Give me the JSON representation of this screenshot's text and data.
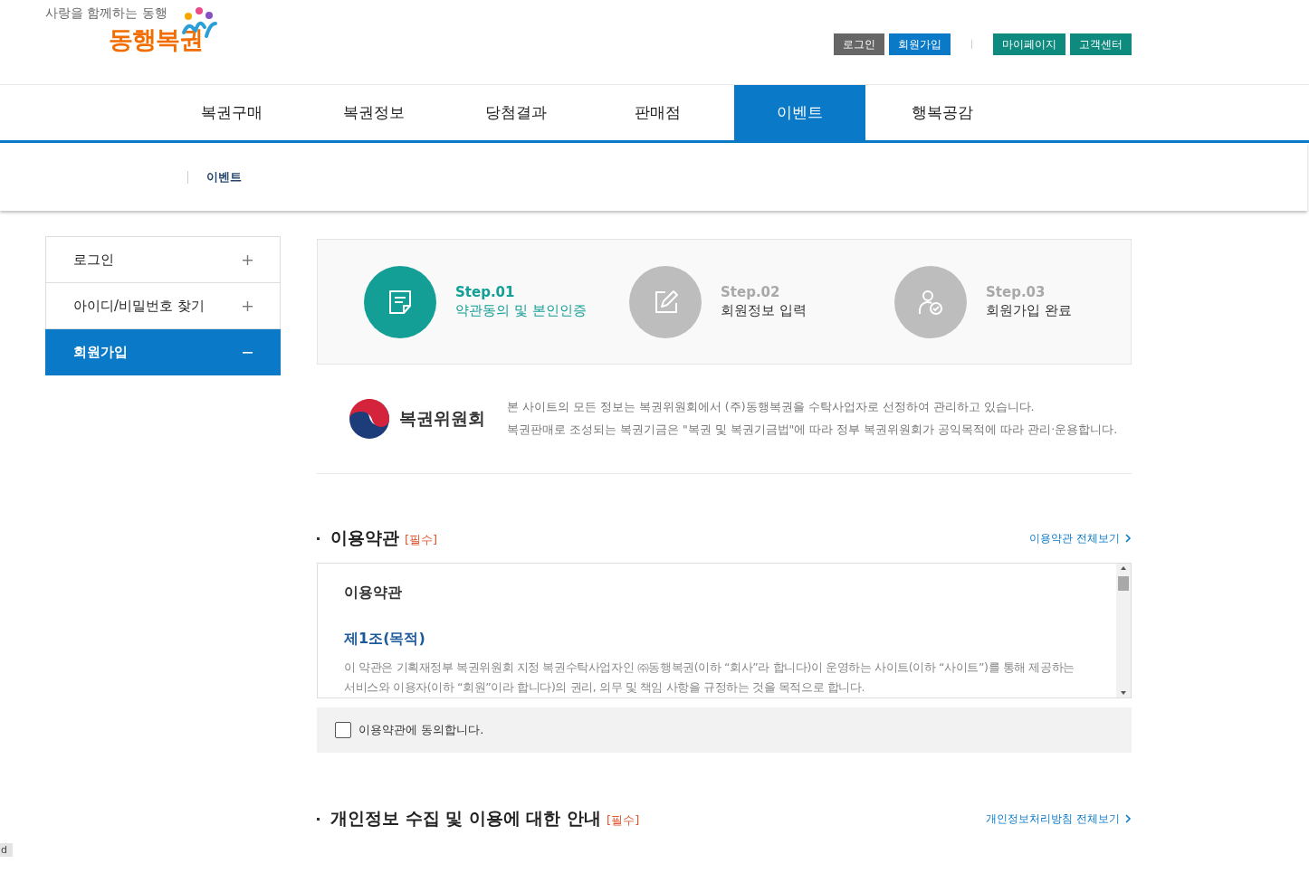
{
  "header": {
    "slogan": "사랑을 함께하는 동행",
    "logo": "동행복권",
    "utility_links": [
      {
        "label": "로그인",
        "color": "#666666"
      },
      {
        "label": "회원가입",
        "color": "#0a7ac8"
      },
      {
        "label": "마이페이지",
        "color": "#0f8a7e"
      },
      {
        "label": "고객센터",
        "color": "#0f8a7e"
      }
    ]
  },
  "nav": {
    "items": [
      {
        "label": "복권구매",
        "selected": false
      },
      {
        "label": "복권정보",
        "selected": false
      },
      {
        "label": "당첨결과",
        "selected": false
      },
      {
        "label": "판매점",
        "selected": false
      },
      {
        "label": "이벤트",
        "selected": true
      },
      {
        "label": "행복공감",
        "selected": false
      }
    ]
  },
  "submenu": {
    "items": [
      "이벤트"
    ]
  },
  "sidebar": {
    "items": [
      {
        "label": "로그인",
        "selected": false,
        "expanded": false
      },
      {
        "label": "아이디/비밀번호 찾기",
        "selected": false,
        "expanded": false
      },
      {
        "label": "회원가입",
        "selected": true,
        "expanded": true
      }
    ]
  },
  "steps": [
    {
      "kind": "note",
      "step": "Step.01",
      "label": "약관동의 및 본인인증",
      "selected": true
    },
    {
      "kind": "edit",
      "step": "Step.02",
      "label": "회원정보 입력",
      "selected": false
    },
    {
      "kind": "user",
      "step": "Step.03",
      "label": "회원가입 완료",
      "selected": false
    }
  ],
  "notice": {
    "org": "복권위원회",
    "lines": [
      "본 사이트의 모든 정보는 복권위원회에서 (주)동행복권을 수탁사업자로 선정하여 관리하고 있습니다.",
      "복권판매로 조성되는 복권기금은 \"복권 및 복권기금법\"에 따라 정부 복권위원회가 공익목적에 따라 관리·운용합니다."
    ]
  },
  "terms": {
    "title": "이용약관",
    "required": "[필수]",
    "link": "이용약관 전체보기",
    "heading": "이용약관",
    "article": "제1조(목적)",
    "body": "이 약관은 기획재정부 복권위원회 지정 복권수탁사업자인 ㈜동행복권(이하 “회사”라 합니다)이 운영하는 사이트(이하 “사이트”)를 통해 제공하는 서비스와 이용자(이하 “회원”이라 합니다)의 권리, 의무 및 책임 사항을 규정하는 것을 목적으로 합니다.",
    "agree": {
      "label": "이용약관에 동의합니다.",
      "checked": false
    }
  },
  "privacy": {
    "title": "개인정보 수집 및 이용에 대한 안내",
    "required": "[필수]",
    "link": "개인정보처리방침 전체보기"
  },
  "corner_tag": "d"
}
